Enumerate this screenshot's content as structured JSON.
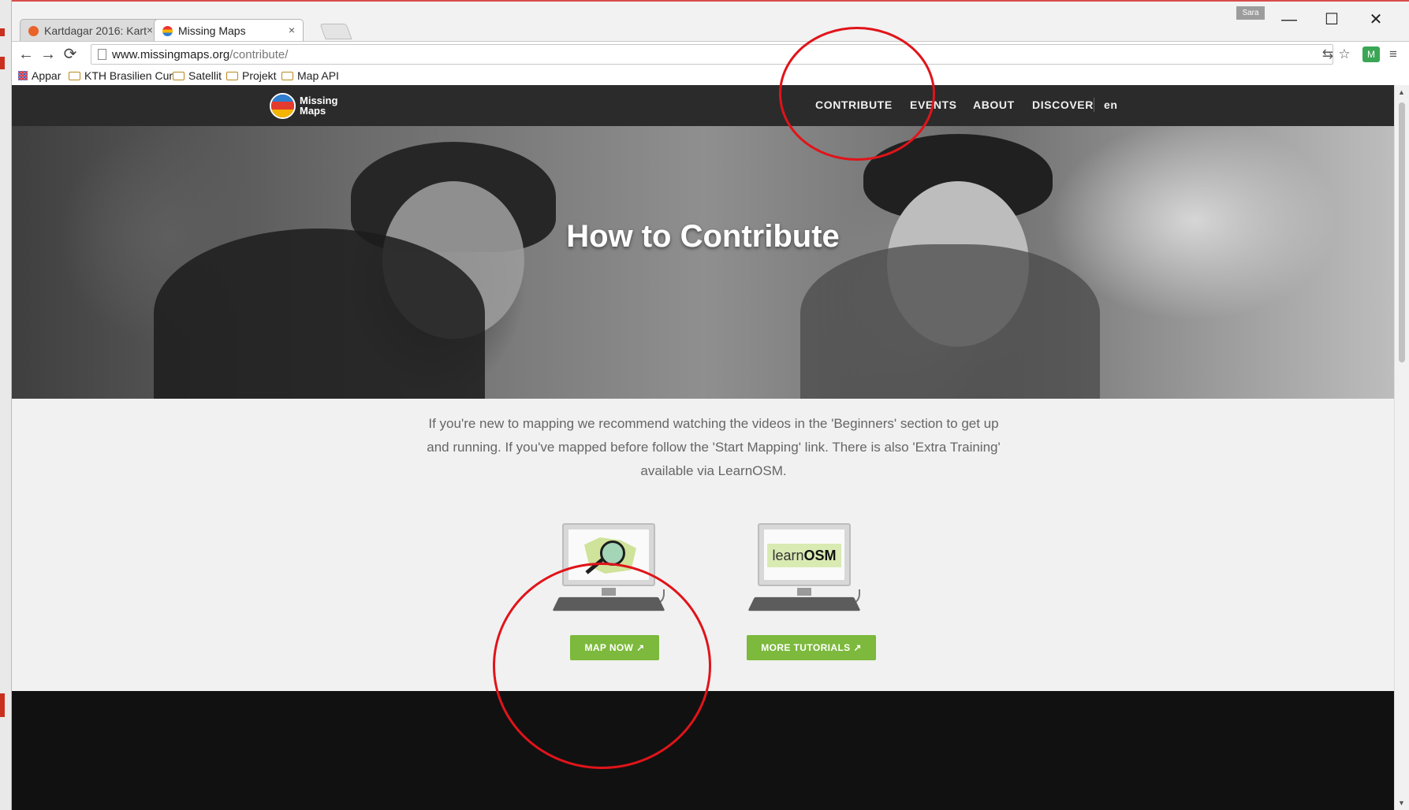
{
  "browser": {
    "tabs": [
      {
        "title": "Kartdagar 2016: Kart",
        "close": "×"
      },
      {
        "title": "Missing Maps",
        "close": "×"
      }
    ],
    "profile_name": "Sara",
    "window_controls": {
      "minimize": "—",
      "maximize": "☐",
      "close": "✕"
    },
    "url_host": "www.missingmaps.org",
    "url_path": "/contribute/",
    "bookmarks": [
      "Appar",
      "KTH Brasilien Cur",
      "Satellit",
      "Projekt",
      "Map API"
    ],
    "icons": [
      "back-arrow-icon",
      "forward-arrow-icon",
      "reload-icon",
      "page-icon",
      "translate-icon",
      "star-icon",
      "extension-icon",
      "menu-icon"
    ]
  },
  "site": {
    "logo_line1": "Missing",
    "logo_line2": "Maps",
    "nav": [
      "CONTRIBUTE",
      "EVENTS",
      "ABOUT",
      "DISCOVER"
    ],
    "language": "en",
    "hero_title": "How to Contribute",
    "intro_lines": [
      "If you're new to mapping we recommend watching the videos in the 'Beginners' section to get up",
      "and running. If you've mapped before follow the 'Start Mapping' link. There is also 'Extra Training'",
      "available via LearnOSM."
    ],
    "card_learn_text_a": "learn",
    "card_learn_text_b": "OSM",
    "map_now_label": "MAP NOW ↗",
    "more_tutorials_label": "MORE TUTORIALS ↗"
  },
  "colors": {
    "nav_bg": "#2b2b2b",
    "accent_green": "#7cb93c",
    "annotation_red": "#e0141a",
    "page_bg": "#f1f1f1"
  }
}
